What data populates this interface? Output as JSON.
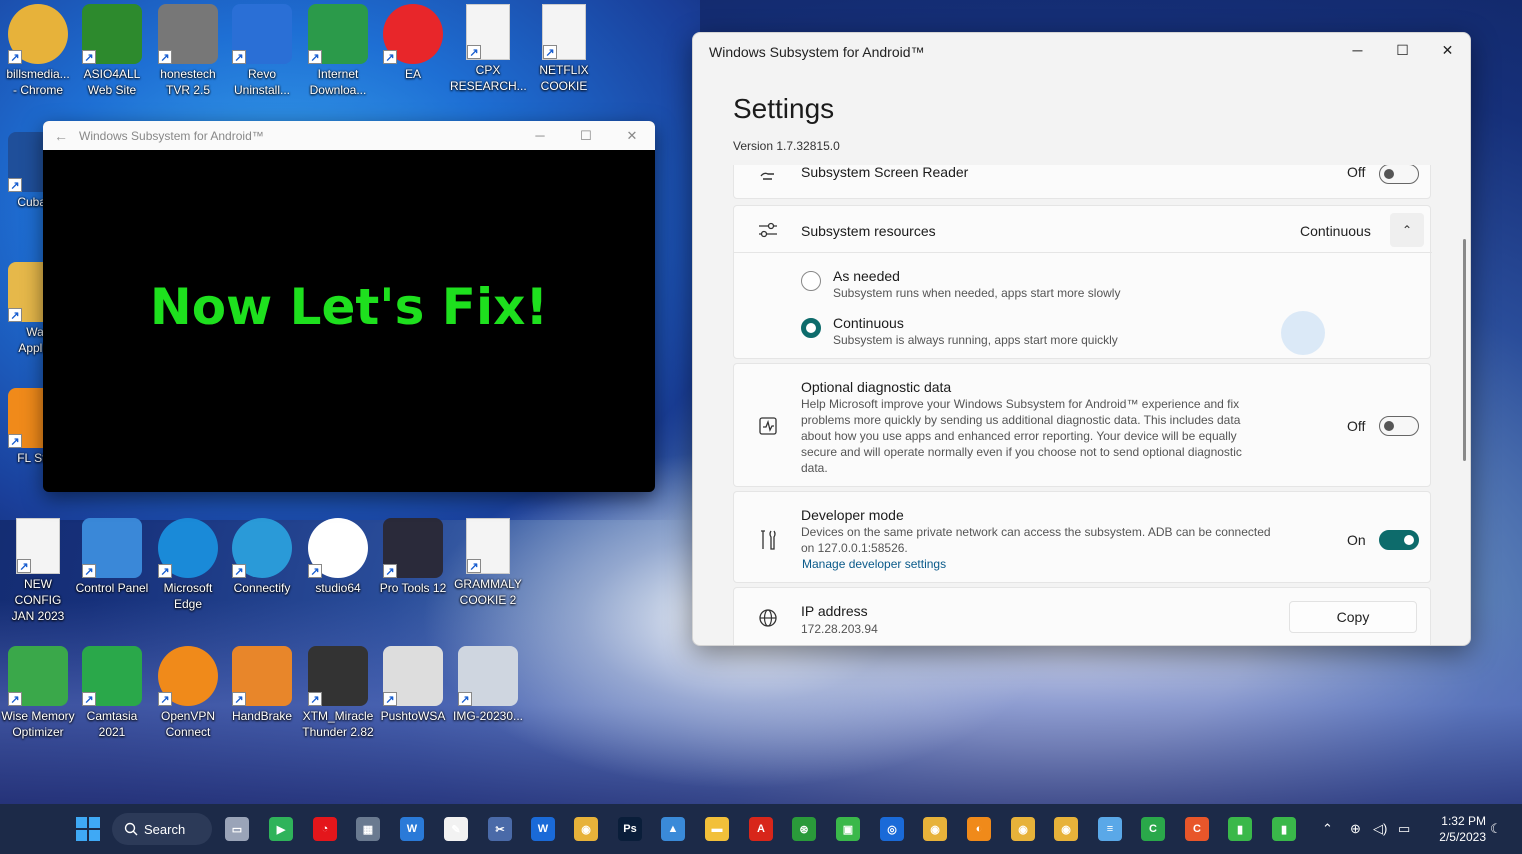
{
  "desktop_icons": [
    {
      "name": "desktop-icon-billsmedia-chrome",
      "label_lines": [
        "billsmedia...",
        "- Chrome"
      ],
      "icon": "chrome-icon",
      "color": "#e7b23a"
    },
    {
      "name": "desktop-icon-asio4all",
      "label_lines": [
        "ASIO4ALL",
        "Web Site"
      ],
      "icon": "asio-icon",
      "color": "#2d8a2d"
    },
    {
      "name": "desktop-icon-honestech",
      "label_lines": [
        "honestech",
        "TVR 2.5"
      ],
      "icon": "tv-icon",
      "color": "#777777"
    },
    {
      "name": "desktop-icon-revo",
      "label_lines": [
        "Revo",
        "Uninstall..."
      ],
      "icon": "revo-icon",
      "color": "#2a6fd6"
    },
    {
      "name": "desktop-icon-internet-download",
      "label_lines": [
        "Internet",
        "Downloa..."
      ],
      "icon": "globe-icon",
      "color": "#2b9a4a"
    },
    {
      "name": "desktop-icon-ea",
      "label_lines": [
        "EA",
        ""
      ],
      "icon": "ea-icon",
      "color": "#e8262a"
    },
    {
      "name": "desktop-icon-cpx",
      "label_lines": [
        "CPX",
        "RESEARCH..."
      ],
      "icon": "document-icon",
      "color": "#f4f4f4"
    },
    {
      "name": "desktop-icon-netflix",
      "label_lines": [
        "NETFLIX",
        "COOKIE"
      ],
      "icon": "document-icon",
      "color": "#f4f4f4"
    },
    {
      "name": "desktop-icon-cubase",
      "label_lines": [
        "Cubase",
        ""
      ],
      "icon": "cubase-icon",
      "color": "#1f4f9a"
    },
    {
      "name": "desktop-icon-waves",
      "label_lines": [
        "Wav",
        "Applica"
      ],
      "icon": "folder-icon",
      "color": "#e6b84a"
    },
    {
      "name": "desktop-icon-flstudio",
      "label_lines": [
        "FL Stud",
        ""
      ],
      "icon": "fl-icon",
      "color": "#f08a1a"
    },
    {
      "name": "desktop-icon-new-config",
      "label_lines": [
        "NEW CONFIG",
        "JAN 2023"
      ],
      "icon": "document-icon",
      "color": "#f4f4f4"
    },
    {
      "name": "desktop-icon-control-panel",
      "label_lines": [
        "Control Panel",
        ""
      ],
      "icon": "control-panel-icon",
      "color": "#3a88d8"
    },
    {
      "name": "desktop-icon-edge",
      "label_lines": [
        "Microsoft",
        "Edge"
      ],
      "icon": "edge-icon",
      "color": "#1a8ad8"
    },
    {
      "name": "desktop-icon-connectify",
      "label_lines": [
        "Connectify",
        ""
      ],
      "icon": "wifi-icon",
      "color": "#2a9ad8"
    },
    {
      "name": "desktop-icon-studio64",
      "label_lines": [
        "studio64",
        ""
      ],
      "icon": "android-studio-icon",
      "color": "#ffffff"
    },
    {
      "name": "desktop-icon-protools",
      "label_lines": [
        "Pro Tools 12",
        ""
      ],
      "icon": "protools-icon",
      "color": "#2a2a3a"
    },
    {
      "name": "desktop-icon-grammaly",
      "label_lines": [
        "GRAMMALY",
        "COOKIE 2"
      ],
      "icon": "document-icon",
      "color": "#f4f4f4"
    },
    {
      "name": "desktop-icon-wise-memory",
      "label_lines": [
        "Wise Memory",
        "Optimizer"
      ],
      "icon": "memory-icon",
      "color": "#3aa84a"
    },
    {
      "name": "desktop-icon-camtasia",
      "label_lines": [
        "Camtasia",
        "2021"
      ],
      "icon": "camtasia-icon",
      "color": "#2aa84a"
    },
    {
      "name": "desktop-icon-openvpn",
      "label_lines": [
        "OpenVPN",
        "Connect"
      ],
      "icon": "vpn-icon",
      "color": "#f08a1a"
    },
    {
      "name": "desktop-icon-handbrake",
      "label_lines": [
        "HandBrake",
        ""
      ],
      "icon": "handbrake-icon",
      "color": "#e8862a"
    },
    {
      "name": "desktop-icon-xtm",
      "label_lines": [
        "XTM_Miracle",
        "Thunder 2.82"
      ],
      "icon": "xtm-icon",
      "color": "#333333"
    },
    {
      "name": "desktop-icon-pushtowsa",
      "label_lines": [
        "PushtoWSA",
        ""
      ],
      "icon": "gear-icon",
      "color": "#dddddd"
    },
    {
      "name": "desktop-icon-img",
      "label_lines": [
        "IMG-20230...",
        ""
      ],
      "icon": "image-icon",
      "color": "#cfd6e0"
    }
  ],
  "mini_window": {
    "title": "Windows Subsystem for Android™",
    "back": "←",
    "minimize": "─",
    "maximize": "☐",
    "close": "✕",
    "overlay_text": "Now Let's Fix!"
  },
  "settings": {
    "title": "Windows Subsystem for Android™",
    "minimize": "─",
    "maximize": "☐",
    "close": "✕",
    "heading": "Settings",
    "version": "Version 1.7.32815.0",
    "screen_reader": {
      "label": "Subsystem Screen Reader",
      "state": "Off",
      "on": false
    },
    "resources": {
      "label": "Subsystem resources",
      "value": "Continuous",
      "chevron": "⌃",
      "options": [
        {
          "label": "As needed",
          "desc": "Subsystem runs when needed, apps start more slowly",
          "checked": false
        },
        {
          "label": "Continuous",
          "desc": "Subsystem is always running, apps start more quickly",
          "checked": true
        }
      ]
    },
    "diagnostic": {
      "label": "Optional diagnostic data",
      "desc": "Help Microsoft improve your Windows Subsystem for Android™ experience and fix problems more quickly by sending us additional diagnostic data. This includes data about how you use apps and enhanced error reporting. Your device will be equally secure and will operate normally even if you choose not to send optional diagnostic data.",
      "state": "Off",
      "on": false
    },
    "developer": {
      "label": "Developer mode",
      "desc": "Devices on the same private network can access the subsystem. ADB can be connected on 127.0.0.1:58526.",
      "link": "Manage developer settings",
      "state": "On",
      "on": true
    },
    "ip": {
      "label": "IP address",
      "value": "172.28.203.94",
      "button": "Copy"
    }
  },
  "taskbar": {
    "search_label": "Search",
    "apps": [
      {
        "name": "taskbar-app-task-view",
        "color": "#9aa4b8",
        "glyph": "▭"
      },
      {
        "name": "taskbar-app-play-store",
        "color": "#2fb35a",
        "glyph": "▶"
      },
      {
        "name": "taskbar-app-vodafone",
        "color": "#e4161b",
        "glyph": "◔"
      },
      {
        "name": "taskbar-app-calculator",
        "color": "#6a7a90",
        "glyph": "▦"
      },
      {
        "name": "taskbar-app-wordpad",
        "color": "#2a7ad8",
        "glyph": "W"
      },
      {
        "name": "taskbar-app-paint",
        "color": "#f2f2f2",
        "glyph": "✎"
      },
      {
        "name": "taskbar-app-snip",
        "color": "#4a6aa8",
        "glyph": "✂"
      },
      {
        "name": "taskbar-app-waves",
        "color": "#1a6ad8",
        "glyph": "W"
      },
      {
        "name": "taskbar-app-chrome",
        "color": "#e7b23a",
        "glyph": "◉"
      },
      {
        "name": "taskbar-app-photoshop",
        "color": "#0a1e3a",
        "glyph": "Ps"
      },
      {
        "name": "taskbar-app-photos",
        "color": "#3a8ad8",
        "glyph": "▲"
      },
      {
        "name": "taskbar-app-file-explorer",
        "color": "#f2c03a",
        "glyph": "▬"
      },
      {
        "name": "taskbar-app-adobe",
        "color": "#d8261a",
        "glyph": "A"
      },
      {
        "name": "taskbar-app-xbox",
        "color": "#2a9a3a",
        "glyph": "⊛"
      },
      {
        "name": "taskbar-app-android",
        "color": "#3ab84a",
        "glyph": "▣"
      },
      {
        "name": "taskbar-app-gamebar",
        "color": "#1a6ad8",
        "glyph": "◎"
      },
      {
        "name": "taskbar-app-chrome-2",
        "color": "#e7b23a",
        "glyph": "◉"
      },
      {
        "name": "taskbar-app-openvpn",
        "color": "#f08a1a",
        "glyph": "◐"
      },
      {
        "name": "taskbar-app-chrome-3",
        "color": "#e7b23a",
        "glyph": "◉"
      },
      {
        "name": "taskbar-app-chrome-4",
        "color": "#e7b23a",
        "glyph": "◉"
      },
      {
        "name": "taskbar-app-notepad",
        "color": "#5aa8e8",
        "glyph": "≡"
      },
      {
        "name": "taskbar-app-camtasia",
        "color": "#2aa84a",
        "glyph": "C"
      },
      {
        "name": "taskbar-app-camtasia-recorder",
        "color": "#e8562a",
        "glyph": "C"
      },
      {
        "name": "taskbar-app-wsa",
        "color": "#3ab84a",
        "glyph": "▮"
      },
      {
        "name": "taskbar-app-wsa-settings",
        "color": "#3ab84a",
        "glyph": "▮"
      }
    ],
    "tray": {
      "chevron": "⌃",
      "network": "⊕",
      "volume": "◁)",
      "battery": "▭"
    },
    "time": "1:32 PM",
    "date": "2/5/2023"
  }
}
